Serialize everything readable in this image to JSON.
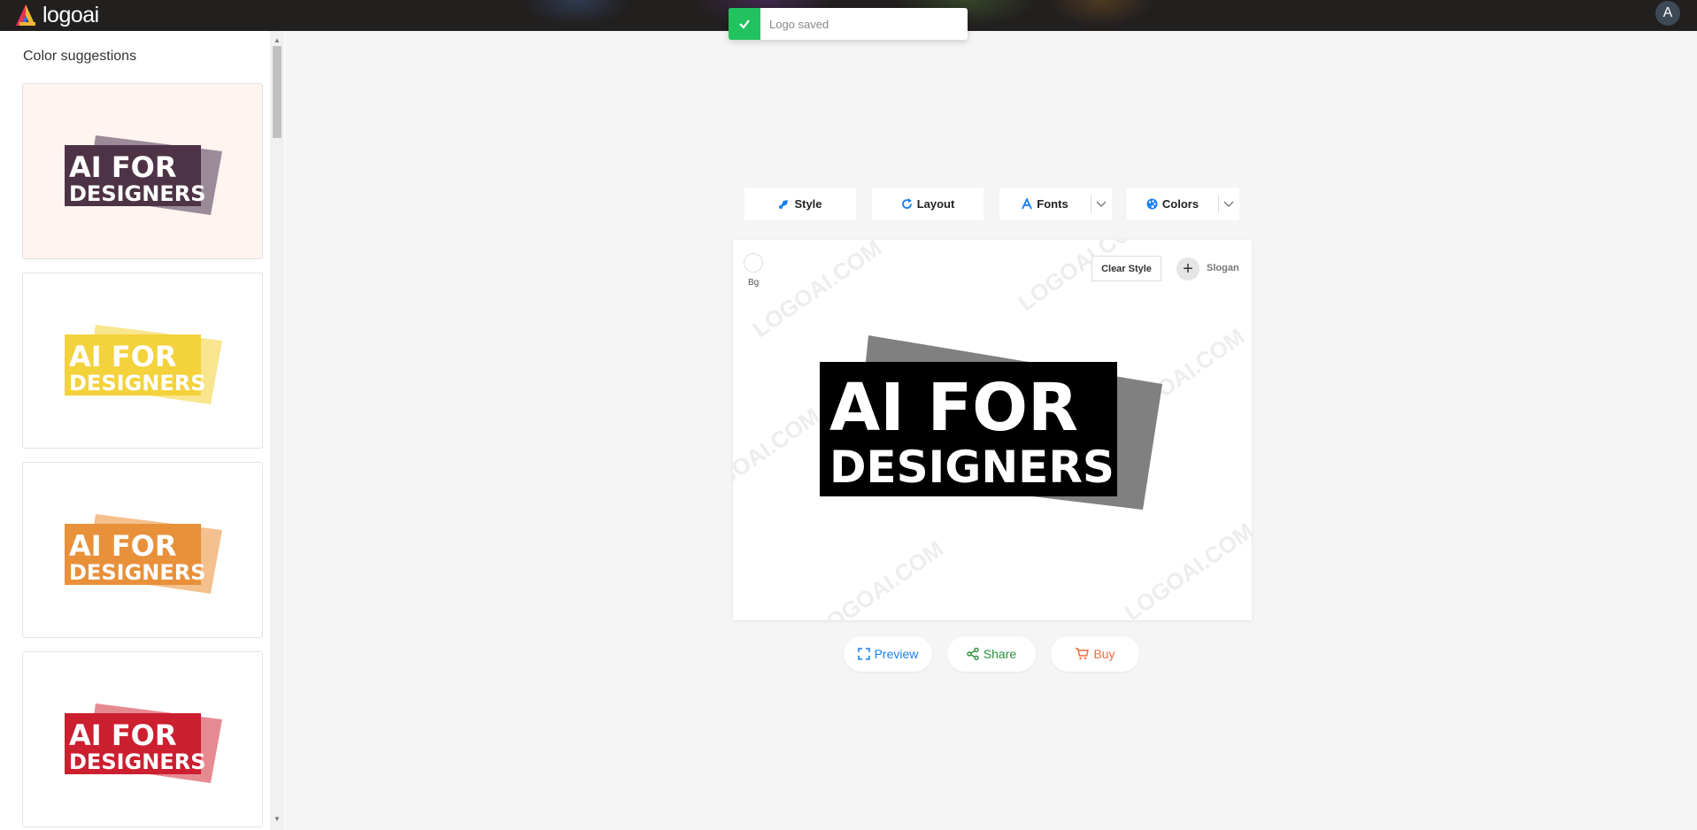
{
  "header": {
    "brand": "logoai",
    "avatar_initial": "A"
  },
  "toast": {
    "message": "Logo saved",
    "icon": "check-icon",
    "color": "#22c35e"
  },
  "sidebar": {
    "title": "Color suggestions",
    "suggestions": [
      {
        "text_line1": "AI FOR",
        "text_line2": "DESIGNERS",
        "primary": "#4e3346",
        "secondary": "#9b8a98",
        "selected": true
      },
      {
        "text_line1": "AI FOR",
        "text_line2": "DESIGNERS",
        "primary": "#f3d23b",
        "secondary": "#f8e58d",
        "selected": false
      },
      {
        "text_line1": "AI FOR",
        "text_line2": "DESIGNERS",
        "primary": "#e8903a",
        "secondary": "#f3c08e",
        "selected": false
      },
      {
        "text_line1": "AI FOR",
        "text_line2": "DESIGNERS",
        "primary": "#cc1f30",
        "secondary": "#e68a92",
        "selected": false
      }
    ]
  },
  "toolbar": {
    "style_label": "Style",
    "layout_label": "Layout",
    "fonts_label": "Fonts",
    "colors_label": "Colors",
    "accent": "#1a7ff0"
  },
  "canvas": {
    "bg_label": "Bg",
    "clear_style_label": "Clear Style",
    "slogan_label": "Slogan",
    "logo_line1": "AI FOR",
    "logo_line2": "DESIGNERS",
    "logo_primary": "#000000",
    "logo_secondary": "#808080",
    "watermark_text": "LOGOAI.COM"
  },
  "actions": {
    "preview_label": "Preview",
    "preview_color": "#1a7ff0",
    "share_label": "Share",
    "share_color": "#2a8f3a",
    "buy_label": "Buy",
    "buy_color": "#f26b3a"
  }
}
